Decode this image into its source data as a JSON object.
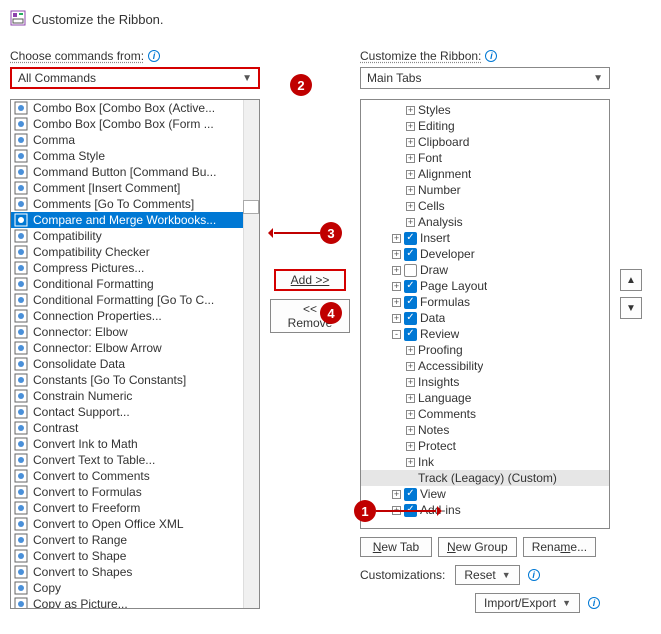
{
  "header": {
    "title": "Customize the Ribbon."
  },
  "left": {
    "label": "Choose commands from:",
    "combo": "All Commands",
    "items": [
      {
        "t": "Combo Box [Combo Box (Active...",
        "sub": false
      },
      {
        "t": "Combo Box [Combo Box (Form ...",
        "sub": false
      },
      {
        "t": "Comma",
        "sub": false
      },
      {
        "t": "Comma Style",
        "sub": false
      },
      {
        "t": "Command Button [Command Bu...",
        "sub": false
      },
      {
        "t": "Comment [Insert Comment]",
        "sub": false
      },
      {
        "t": "Comments [Go To Comments]",
        "sub": false
      },
      {
        "t": "Compare and Merge Workbooks...",
        "sub": false,
        "sel": true
      },
      {
        "t": "Compatibility",
        "sub": true
      },
      {
        "t": "Compatibility Checker",
        "sub": false
      },
      {
        "t": "Compress Pictures...",
        "sub": false
      },
      {
        "t": "Conditional Formatting",
        "sub": true
      },
      {
        "t": "Conditional Formatting [Go To C...",
        "sub": false
      },
      {
        "t": "Connection Properties...",
        "sub": false
      },
      {
        "t": "Connector: Elbow",
        "sub": false
      },
      {
        "t": "Connector: Elbow Arrow",
        "sub": false
      },
      {
        "t": "Consolidate Data",
        "sub": false
      },
      {
        "t": "Constants [Go To Constants]",
        "sub": false
      },
      {
        "t": "Constrain Numeric",
        "sub": false
      },
      {
        "t": "Contact Support...",
        "sub": false
      },
      {
        "t": "Contrast",
        "sub": true
      },
      {
        "t": "Convert Ink to Math",
        "sub": false
      },
      {
        "t": "Convert Text to Table...",
        "sub": false
      },
      {
        "t": "Convert to Comments",
        "sub": false
      },
      {
        "t": "Convert to Formulas",
        "sub": false
      },
      {
        "t": "Convert to Freeform",
        "sub": false
      },
      {
        "t": "Convert to Open Office XML",
        "sub": false
      },
      {
        "t": "Convert to Range",
        "sub": false
      },
      {
        "t": "Convert to Shape",
        "sub": false
      },
      {
        "t": "Convert to Shapes",
        "sub": false
      },
      {
        "t": "Copy",
        "sub": false
      },
      {
        "t": "Copy as Picture...",
        "sub": false
      }
    ]
  },
  "mid": {
    "add": "Add >>",
    "remove": "<< Remove"
  },
  "right": {
    "label": "Customize the Ribbon:",
    "combo": "Main Tabs",
    "tree": [
      {
        "d": 3,
        "exp": "+",
        "t": "Styles"
      },
      {
        "d": 3,
        "exp": "+",
        "t": "Editing"
      },
      {
        "d": 3,
        "exp": "+",
        "t": "Clipboard"
      },
      {
        "d": 3,
        "exp": "+",
        "t": "Font"
      },
      {
        "d": 3,
        "exp": "+",
        "t": "Alignment"
      },
      {
        "d": 3,
        "exp": "+",
        "t": "Number"
      },
      {
        "d": 3,
        "exp": "+",
        "t": "Cells"
      },
      {
        "d": 3,
        "exp": "+",
        "t": "Analysis"
      },
      {
        "d": 2,
        "exp": "+",
        "chk": true,
        "t": "Insert"
      },
      {
        "d": 2,
        "exp": "+",
        "chk": true,
        "t": "Developer"
      },
      {
        "d": 2,
        "exp": "+",
        "chk": false,
        "t": "Draw"
      },
      {
        "d": 2,
        "exp": "+",
        "chk": true,
        "t": "Page Layout"
      },
      {
        "d": 2,
        "exp": "+",
        "chk": true,
        "t": "Formulas"
      },
      {
        "d": 2,
        "exp": "+",
        "chk": true,
        "t": "Data"
      },
      {
        "d": 2,
        "exp": "-",
        "chk": true,
        "t": "Review"
      },
      {
        "d": 3,
        "exp": "+",
        "t": "Proofing"
      },
      {
        "d": 3,
        "exp": "+",
        "t": "Accessibility"
      },
      {
        "d": 3,
        "exp": "+",
        "t": "Insights"
      },
      {
        "d": 3,
        "exp": "+",
        "t": "Language"
      },
      {
        "d": 3,
        "exp": "+",
        "t": "Comments"
      },
      {
        "d": 3,
        "exp": "+",
        "t": "Notes"
      },
      {
        "d": 3,
        "exp": "+",
        "t": "Protect"
      },
      {
        "d": 3,
        "exp": "+",
        "t": "Ink"
      },
      {
        "d": 3,
        "exp": " ",
        "t": "Track (Leagacy) (Custom)",
        "hl": true
      },
      {
        "d": 2,
        "exp": "+",
        "chk": true,
        "t": "View"
      },
      {
        "d": 2,
        "exp": "+",
        "chk": true,
        "t": "Add-ins"
      }
    ],
    "newTab": "New Tab",
    "newGroup": "New Group",
    "rename": "Rename...",
    "customizations": "Customizations:",
    "reset": "Reset",
    "importExport": "Import/Export"
  },
  "callouts": {
    "c1": "1",
    "c2": "2",
    "c3": "3",
    "c4": "4"
  }
}
